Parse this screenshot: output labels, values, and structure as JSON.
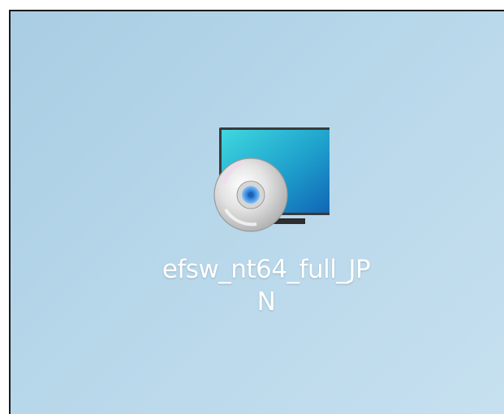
{
  "desktop": {
    "background_color": "#b7d7ea",
    "icons": [
      {
        "icon": "disc-installer-icon",
        "label_line1": "efsw_nt64_full_JP",
        "label_line2": "N"
      }
    ]
  },
  "colors": {
    "monitor_screen_top": "#35d0dd",
    "monitor_screen_bottom": "#1275bd",
    "disc_center": "#2f7fd4",
    "label_text": "#ffffff"
  }
}
